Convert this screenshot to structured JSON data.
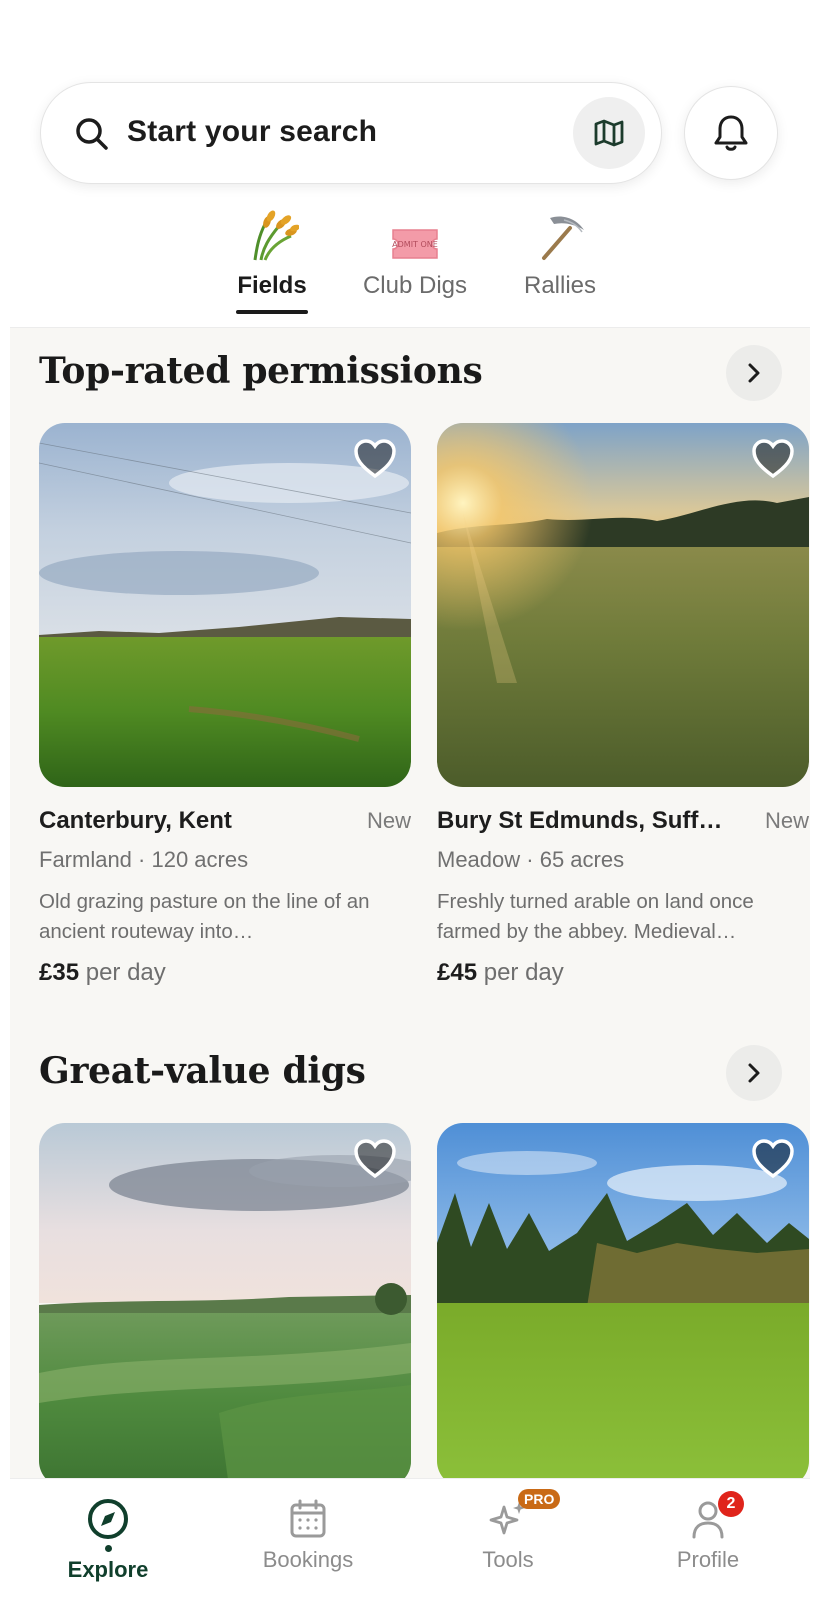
{
  "search": {
    "placeholder": "Start your search"
  },
  "tabs": [
    {
      "label": "Fields",
      "icon": "wheat-icon",
      "active": true
    },
    {
      "label": "Club Digs",
      "icon": "admit-one-ticket-icon",
      "ticket_text": "ADMIT ONE",
      "active": false
    },
    {
      "label": "Rallies",
      "icon": "pickaxe-icon",
      "active": false
    }
  ],
  "sections": [
    {
      "title": "Top-rated permissions",
      "cards": [
        {
          "place": "Canterbury, Kent",
          "badge": "New",
          "meta": "Farmland · 120 acres",
          "description": "Old grazing pasture on the line of an ancient routeway into…",
          "price": "£35",
          "price_unit": "per day"
        },
        {
          "place": "Bury St Edmunds, Suff…",
          "badge": "New",
          "meta": "Meadow · 65 acres",
          "description": "Freshly turned arable on land once farmed by the abbey. Medieval…",
          "price": "£45",
          "price_unit": "per day"
        }
      ]
    },
    {
      "title": "Great-value digs",
      "cards": [
        {},
        {}
      ]
    }
  ],
  "nav": [
    {
      "label": "Explore",
      "icon": "compass-icon",
      "active": true
    },
    {
      "label": "Bookings",
      "icon": "calendar-icon",
      "active": false
    },
    {
      "label": "Tools",
      "icon": "sparkle-icon",
      "badge": "PRO",
      "active": false
    },
    {
      "label": "Profile",
      "icon": "person-icon",
      "badge": "2",
      "active": false
    }
  ],
  "colors": {
    "accent": "#103f2c",
    "pro_badge": "#c96a16",
    "notif_badge": "#e0241b"
  }
}
